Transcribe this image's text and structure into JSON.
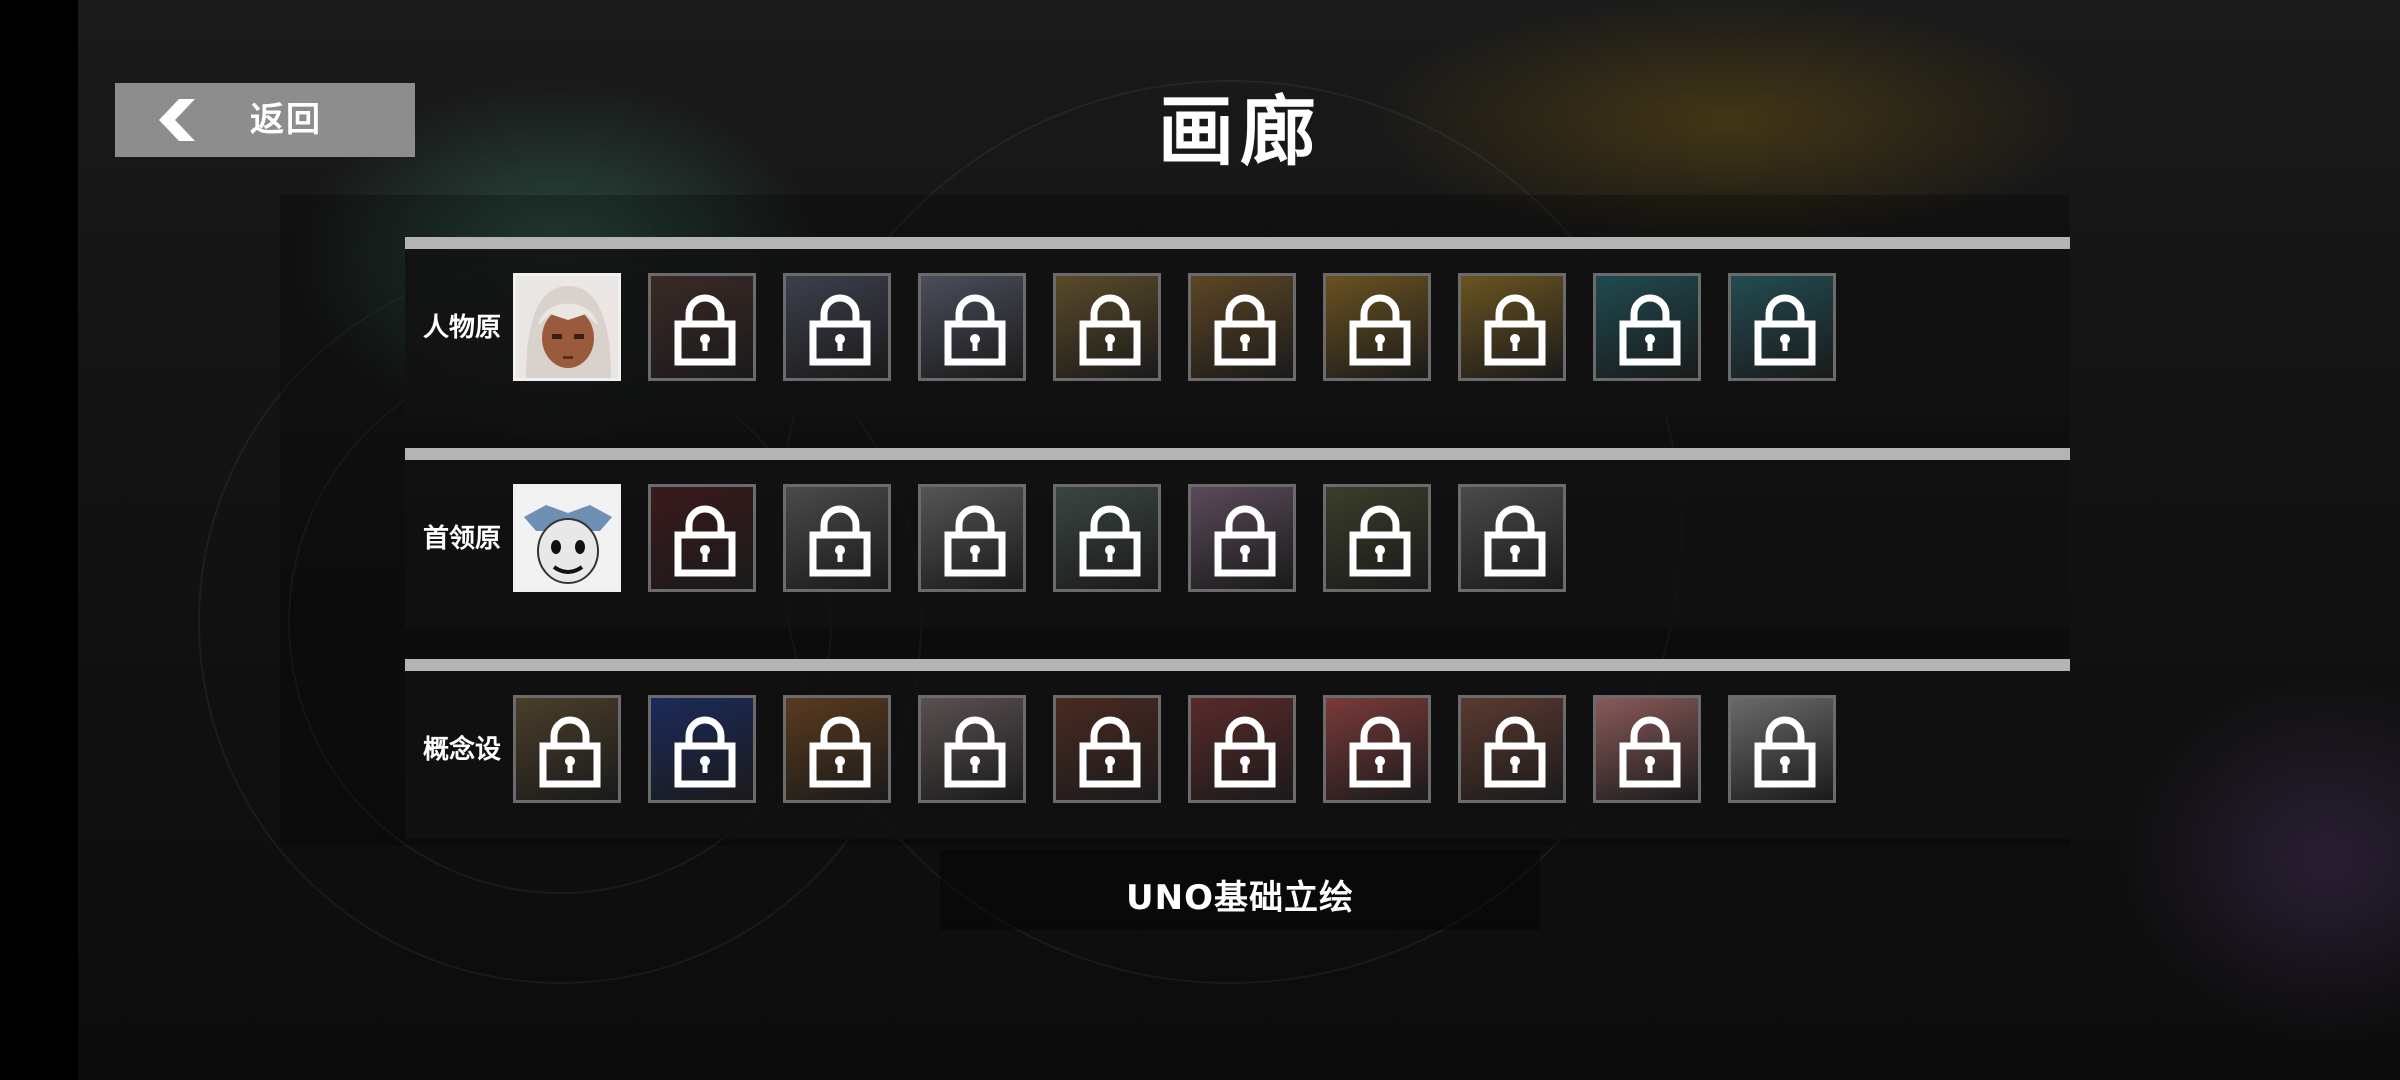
{
  "header": {
    "back_label": "返回",
    "title": "画廊"
  },
  "sections": [
    {
      "label": "人物原",
      "items": [
        {
          "state": "unlocked",
          "tint": "#c7a48f"
        },
        {
          "state": "locked",
          "tint": "#3a2a26"
        },
        {
          "state": "locked",
          "tint": "#3c404c"
        },
        {
          "state": "locked",
          "tint": "#4a4e5a"
        },
        {
          "state": "locked",
          "tint": "#5a4a2a"
        },
        {
          "state": "locked",
          "tint": "#5c4624"
        },
        {
          "state": "locked",
          "tint": "#6a5220"
        },
        {
          "state": "locked",
          "tint": "#6a5420"
        },
        {
          "state": "locked",
          "tint": "#1f4a50"
        },
        {
          "state": "locked",
          "tint": "#224c52"
        }
      ]
    },
    {
      "label": "首领原",
      "items": [
        {
          "state": "unlocked",
          "tint": "#cfd6de"
        },
        {
          "state": "locked",
          "tint": "#3a1a1c"
        },
        {
          "state": "locked",
          "tint": "#4a4a4a"
        },
        {
          "state": "locked",
          "tint": "#555555"
        },
        {
          "state": "locked",
          "tint": "#3a4640"
        },
        {
          "state": "locked",
          "tint": "#5a4a5a"
        },
        {
          "state": "locked",
          "tint": "#3a3e2a"
        },
        {
          "state": "locked",
          "tint": "#4a4a4a"
        }
      ]
    },
    {
      "label": "概念设",
      "items": [
        {
          "state": "locked",
          "tint": "#4a3e2a"
        },
        {
          "state": "locked",
          "tint": "#1c2a5a"
        },
        {
          "state": "locked",
          "tint": "#5a3a1e"
        },
        {
          "state": "locked",
          "tint": "#5a5050"
        },
        {
          "state": "locked",
          "tint": "#4a2a22"
        },
        {
          "state": "locked",
          "tint": "#5a2a2a"
        },
        {
          "state": "locked",
          "tint": "#7a3a3a"
        },
        {
          "state": "locked",
          "tint": "#5a3a30"
        },
        {
          "state": "locked",
          "tint": "#8a5a5a"
        },
        {
          "state": "locked",
          "tint": "#6a6a6a"
        }
      ]
    }
  ],
  "footer": {
    "caption": "UNO基础立绘"
  },
  "icons": {
    "lock": "lock-icon",
    "back": "chevron-left-icon"
  }
}
